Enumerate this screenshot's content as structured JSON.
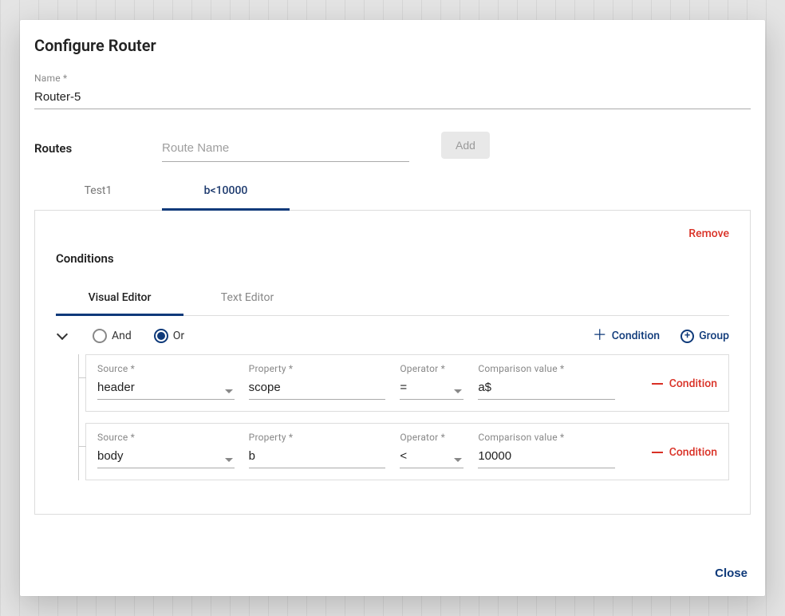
{
  "dialog": {
    "title": "Configure Router",
    "close_label": "Close"
  },
  "name_field": {
    "label": "Name",
    "value": "Router-5"
  },
  "routes_section": {
    "heading": "Routes",
    "route_name_placeholder": "Route Name",
    "add_label": "Add",
    "remove_label": "Remove",
    "tabs": [
      {
        "label": "Test1",
        "active": false
      },
      {
        "label": "b<10000",
        "active": true
      }
    ]
  },
  "conditions": {
    "heading": "Conditions",
    "editor_tabs": {
      "visual": "Visual Editor",
      "text": "Text Editor"
    },
    "logic": {
      "and": "And",
      "or": "Or",
      "selected": "or"
    },
    "toolbar": {
      "add_condition": "Condition",
      "add_group": "Group"
    },
    "field_labels": {
      "source": "Source",
      "property": "Property",
      "operator": "Operator",
      "comparison": "Comparison value"
    },
    "remove_condition_label": "Condition",
    "rows": [
      {
        "source": "header",
        "property": "scope",
        "operator": "=",
        "comparison": "a$"
      },
      {
        "source": "body",
        "property": "b",
        "operator": "<",
        "comparison": "10000"
      }
    ]
  }
}
